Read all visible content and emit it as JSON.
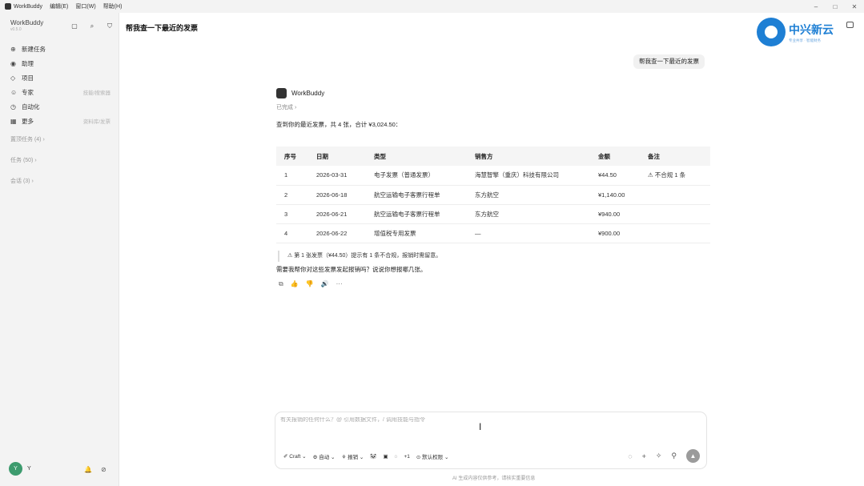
{
  "menubar": {
    "app": "WorkBuddy",
    "items": [
      "编辑(E)",
      "窗口(W)",
      "帮助(H)"
    ]
  },
  "window_controls": [
    "–",
    "□",
    "✕"
  ],
  "sidebar": {
    "brand": "WorkBuddy",
    "version": "v0.5.0",
    "nav": [
      {
        "label": "新建任务",
        "icon": "⊕",
        "hint": ""
      },
      {
        "label": "助理",
        "icon": "◉",
        "hint": ""
      },
      {
        "label": "项目",
        "icon": "◇",
        "hint": ""
      },
      {
        "label": "专家",
        "icon": "☺",
        "hint": "技能/搜索器"
      },
      {
        "label": "自动化",
        "icon": "◷",
        "hint": ""
      },
      {
        "label": "更多",
        "icon": "▦",
        "hint": "资料库/发票"
      }
    ],
    "sections": [
      "置顶任务 (4) ›",
      "任务 (50) ›",
      "会话 (3) ›"
    ],
    "user_initial": "Y",
    "user_name": "Y"
  },
  "main": {
    "title": "帮我查一下最近的发票",
    "brand_logo": {
      "main": "中兴新云",
      "sub": "专业共享 · 智能财务",
      "color": "#1e7fd4"
    },
    "user_message": "帮我查一下最近的发票",
    "agent_name": "WorkBuddy",
    "status": "已完成 ›",
    "summary": "查到你的最近发票，共 4 张，合计 ¥3,024.50：",
    "table": {
      "headers": [
        "序号",
        "日期",
        "类型",
        "销售方",
        "金额",
        "备注"
      ],
      "rows": [
        [
          "1",
          "2026-03-31",
          "电子发票（普通发票）",
          "海慧智擎（重庆）科技有限公司",
          "¥44.50",
          "⚠ 不合规 1 条"
        ],
        [
          "2",
          "2026-06-18",
          "航空运输电子客票行程单",
          "东方航空",
          "¥1,140.00",
          ""
        ],
        [
          "3",
          "2026-06-21",
          "航空运输电子客票行程单",
          "东方航空",
          "¥940.00",
          ""
        ],
        [
          "4",
          "2026-06-22",
          "增值税专用发票",
          "—",
          "¥900.00",
          ""
        ]
      ]
    },
    "note": "⚠ 第 1 张发票（¥44.50）提示有 1 条不合规，报销时需留意。",
    "question": "需要我帮你对这些发票发起报销吗？说说你想报哪几张。",
    "actions": [
      "⧉",
      "👍",
      "👎",
      "🔊",
      "···"
    ]
  },
  "composer": {
    "placeholder": "有关报销的任何什么？@ 引用数据文件，/ 调用技能与指令",
    "tools": [
      "✐ Craft ⌄",
      "⚙ 自动 ⌄",
      "⚘ 报销 ⌄",
      "🐼",
      "▣",
      "◌",
      "+1",
      "⊙ 默认权限 ⌄"
    ],
    "right_tools": [
      "◌",
      "+",
      "✧",
      "⚲"
    ],
    "send": "▲"
  },
  "disclaimer": "AI 生成内容仅供参考，请核实重要信息"
}
